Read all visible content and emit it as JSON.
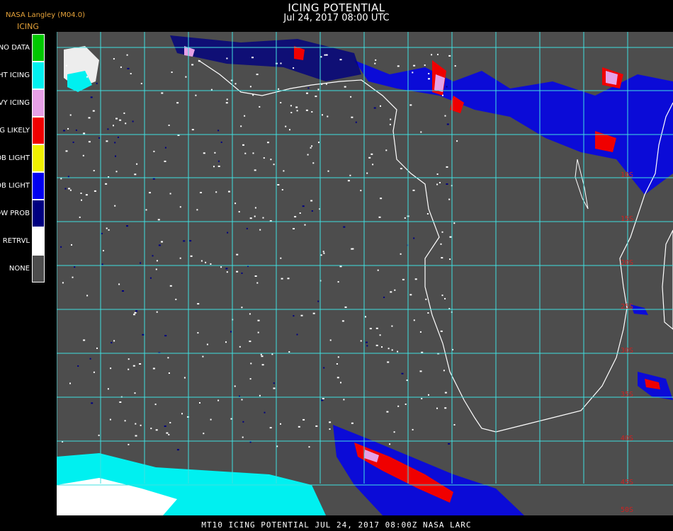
{
  "header": {
    "title": "ICING POTENTIAL",
    "subtitle": "Jul 24, 2017 08:00 UTC",
    "source": "NASA Langley (M04.0)"
  },
  "legend": {
    "title": "ICING",
    "items": [
      {
        "label": "NO DATA",
        "color": "#00c800"
      },
      {
        "label": "NIGHT ICING",
        "color": "#00f0f0"
      },
      {
        "label": "HEAVY ICING",
        "color": "#e6a0e6"
      },
      {
        "label": "MOG LIKELY",
        "color": "#f00000"
      },
      {
        "label": "HI PROB LIGHT",
        "color": "#f0f000"
      },
      {
        "label": "LO PROB LIGHT",
        "color": "#0000f0"
      },
      {
        "label": "LOW PROB",
        "color": "#000080"
      },
      {
        "label": "NO RETRVL",
        "color": "#ffffff"
      },
      {
        "label": "NONE",
        "color": "#4d4d4d"
      }
    ]
  },
  "map": {
    "grid_color": "#40e0e0",
    "coast_color": "#ffffff",
    "lat_labels": [
      "10S",
      "15S",
      "20S",
      "25S",
      "30S",
      "35S",
      "40S",
      "45S",
      "50S"
    ]
  },
  "footer": {
    "text": "MT10  ICING POTENTIAL   JUL 24, 2017 08:00Z   NASA LARC"
  }
}
